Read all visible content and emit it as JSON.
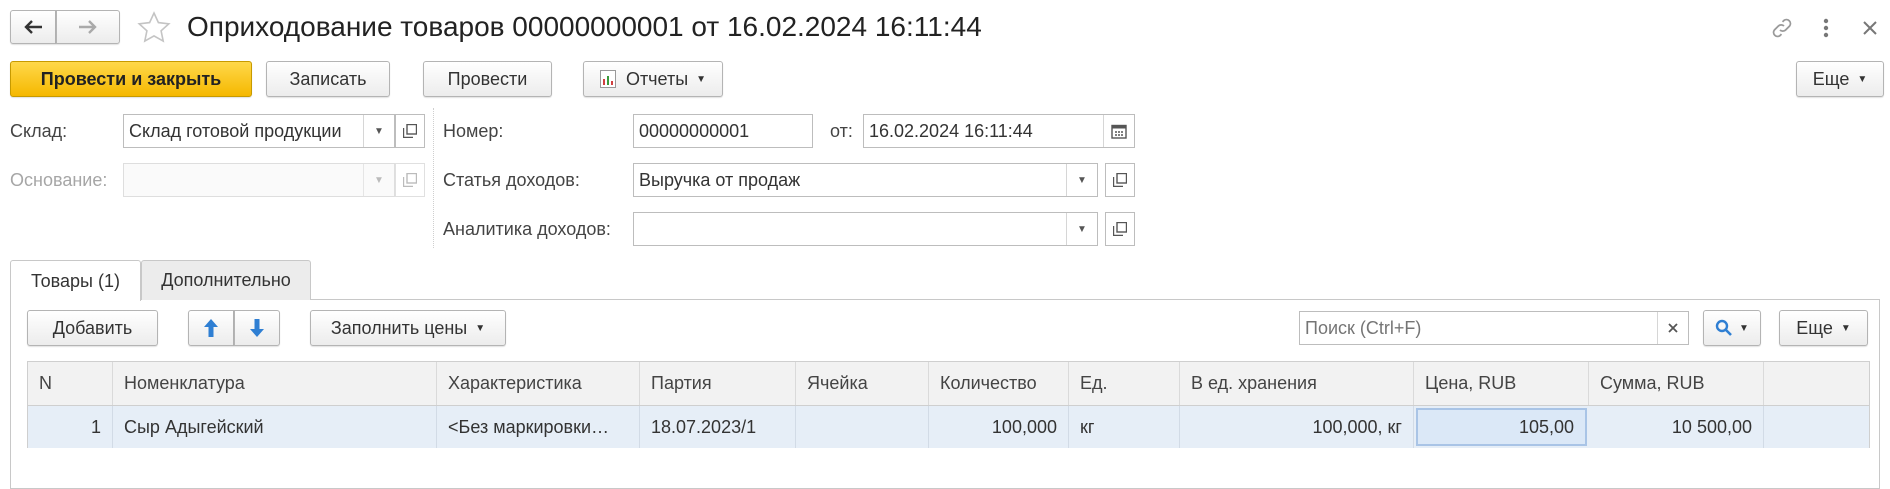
{
  "window": {
    "title": "Оприходование товаров 00000000001 от 16.02.2024 16:11:44"
  },
  "toolbar": {
    "post_and_close": "Провести и закрыть",
    "save": "Записать",
    "post": "Провести",
    "reports": "Отчеты",
    "more": "Еще"
  },
  "form": {
    "warehouse_label": "Склад:",
    "warehouse_value": "Склад готовой продукции",
    "basis_label": "Основание:",
    "basis_value": "",
    "number_label": "Номер:",
    "number_value": "00000000001",
    "date_label": "от:",
    "date_value": "16.02.2024 16:11:44",
    "income_item_label": "Статья доходов:",
    "income_item_value": "Выручка от продаж",
    "income_analytics_label": "Аналитика доходов:",
    "income_analytics_value": ""
  },
  "tabs": [
    {
      "label": "Товары (1)",
      "active": true
    },
    {
      "label": "Дополнительно",
      "active": false
    }
  ],
  "table_toolbar": {
    "add": "Добавить",
    "fill_prices": "Заполнить цены",
    "search_placeholder": "Поиск (Ctrl+F)",
    "more": "Еще"
  },
  "table": {
    "columns": [
      "N",
      "Номенклатура",
      "Характеристика",
      "Партия",
      "Ячейка",
      "Количество",
      "Ед.",
      "В ед. хранения",
      "Цена, RUB",
      "Сумма, RUB"
    ],
    "rows": [
      [
        "1",
        "Сыр Адыгейский",
        "<Без маркировки…",
        "18.07.2023/1",
        "",
        "100,000",
        "кг",
        "100,000, кг",
        "105,00",
        "10 500,00"
      ]
    ]
  },
  "colors": {
    "primary_button": "#f5b800",
    "selected_row": "#e6eef7",
    "accent_blue": "#2f7fd3"
  }
}
